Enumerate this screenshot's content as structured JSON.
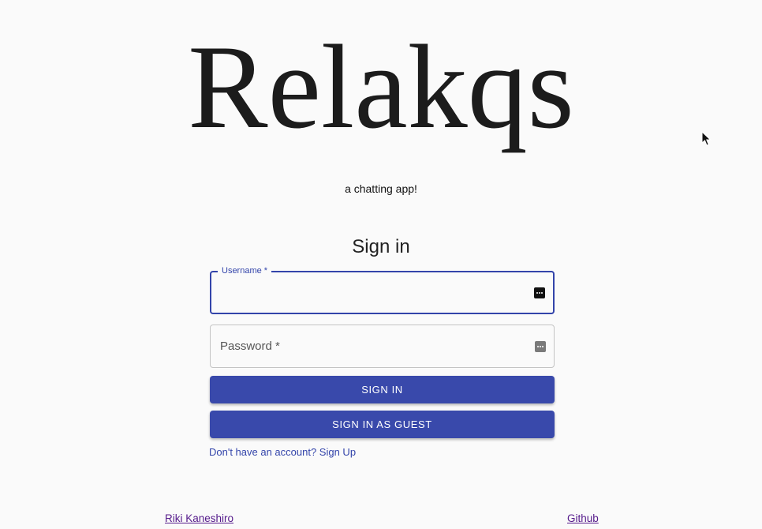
{
  "app": {
    "logo_text": "Relakqs",
    "tagline": "a chatting app!"
  },
  "signin": {
    "title": "Sign in",
    "username": {
      "label": "Username *",
      "value": ""
    },
    "password": {
      "placeholder": "Password *",
      "value": ""
    },
    "signin_button": "SIGN IN",
    "guest_button": "SIGN IN AS GUEST",
    "signup_link": "Don't have an account? Sign Up"
  },
  "footer": {
    "author_link": "Riki Kaneshiro",
    "github_link": "Github"
  },
  "icons": {
    "password_manager": "password-manager-key-icon",
    "cursor": "mouse-pointer-icon"
  },
  "colors": {
    "primary": "#3949ab",
    "background": "#fafafa",
    "visited_link": "#551a8b"
  }
}
